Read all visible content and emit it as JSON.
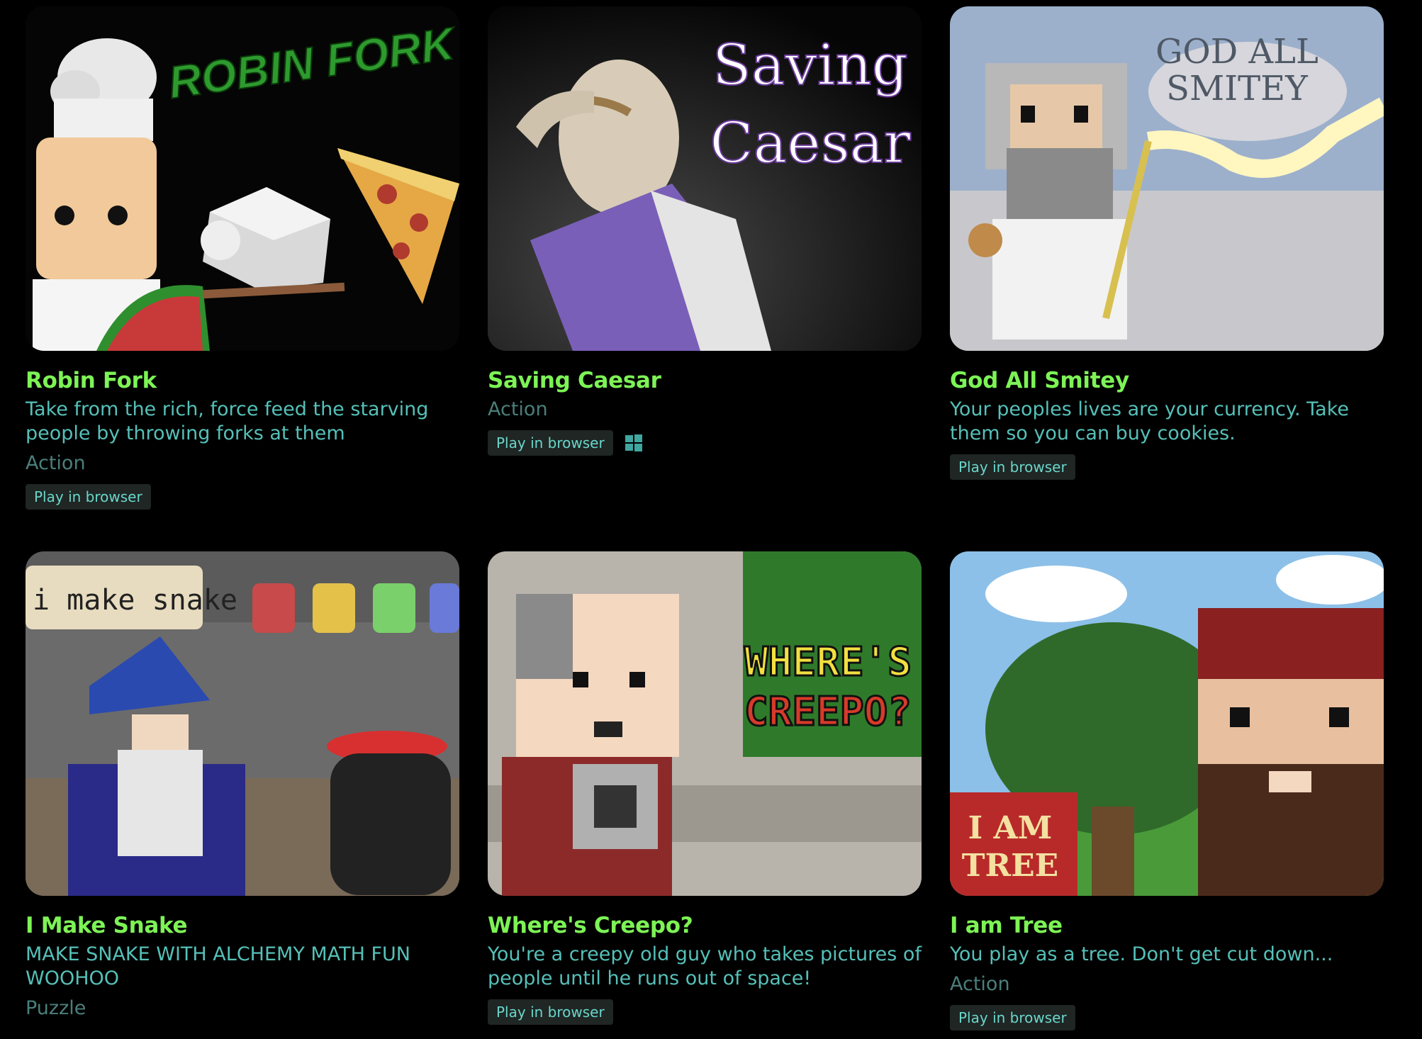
{
  "games": [
    {
      "title": "Robin Fork",
      "description": "Take from the rich, force feed the starving people by throwing forks at them",
      "genre": "Action",
      "tag": "Play in browser",
      "cover_text": "ROBIN FORK"
    },
    {
      "title": "Saving Caesar",
      "description": "",
      "genre": "Action",
      "tag": "Play in browser",
      "platform_icon": "windows-icon",
      "cover_text_1": "Saving",
      "cover_text_2": "Caesar"
    },
    {
      "title": "God All Smitey",
      "description": "Your peoples lives are your currency. Take them so you can buy cookies.",
      "genre": "",
      "tag": "Play in browser",
      "cover_text_1": "GOD ALL",
      "cover_text_2": "SMITEY"
    },
    {
      "title": "I Make Snake",
      "description": "MAKE SNAKE WITH ALCHEMY MATH FUN WOOHOO",
      "genre": "Puzzle",
      "tag": "",
      "cover_text": "i make snake"
    },
    {
      "title": "Where's Creepo?",
      "description": "You're a creepy old guy who takes pictures of people until he runs out of space!",
      "genre": "",
      "tag": "Play in browser",
      "cover_text_1": "WHERE'S",
      "cover_text_2": "CREEPO?"
    },
    {
      "title": "I am Tree",
      "description": "You play as a tree. Don't get cut down...",
      "genre": "Action",
      "tag": "Play in browser",
      "cover_text_1": "I AM",
      "cover_text_2": "TREE"
    }
  ],
  "colors": {
    "title": "#7df356",
    "description": "#55c0b8",
    "genre": "#4a7f7b",
    "tag_bg": "#1f2624",
    "tag_text": "#6ad6ca",
    "background": "#000000"
  }
}
